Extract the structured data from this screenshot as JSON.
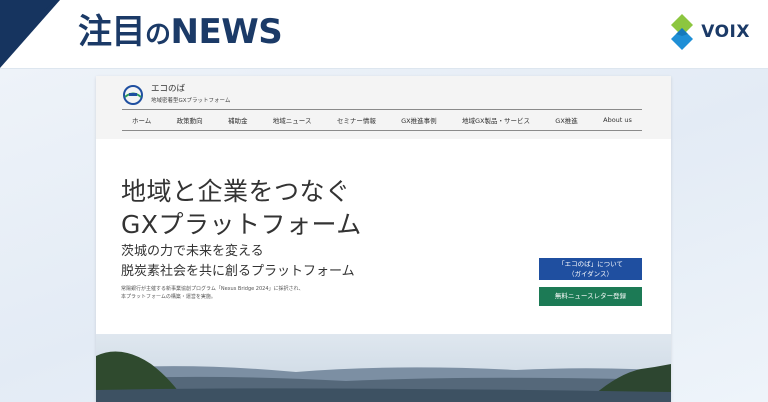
{
  "header": {
    "headline_main": "注目の",
    "headline_small": "の",
    "headline_suffix": "NEWS",
    "brand_name": "VOIX"
  },
  "site": {
    "name": "エコのば",
    "tagline": "地域密着型GXプラットフォーム",
    "nav": [
      "ホーム",
      "政策動向",
      "補助金",
      "地域ニュース",
      "セミナー情報",
      "GX推進事例",
      "地域GX製品・サービス",
      "GX推進",
      "About us"
    ]
  },
  "hero": {
    "title_line1": "地域と企業をつなぐ",
    "title_line2": "GXプラットフォーム",
    "sub_line1": "茨城の力で未来を変える",
    "sub_line2": "脱炭素社会を共に創るプラットフォーム",
    "note_line1": "常陽銀行が主催する新事業協創プログラム「Nexus Bridge 2024」に採択され、",
    "note_line2": "本プラットフォームの構築・運営を実施。",
    "guide_button_line1": "「エコのば」について",
    "guide_button_line2": "（ガイダンス）",
    "news_button": "無料ニュースレター登録"
  },
  "colors": {
    "navy": "#1b3a67",
    "guide_button": "#1f4fa0",
    "news_button": "#1c7a55",
    "brand_green": "#8cc63f",
    "brand_blue": "#1f8fd6"
  }
}
